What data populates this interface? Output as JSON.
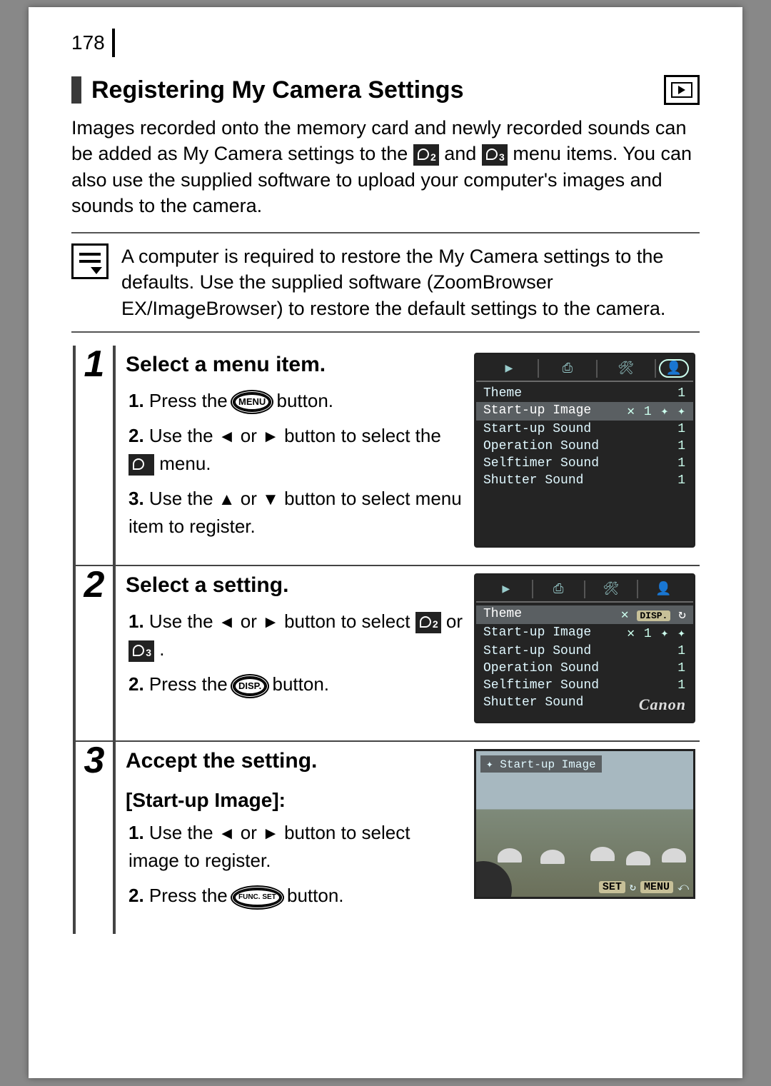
{
  "page_number": "178",
  "section_title": "Registering My Camera Settings",
  "intro": "Images recorded onto the memory card and newly recorded sounds can be added as My Camera settings to the     and     menu items. You can also use the supplied software to upload your computer's images and sounds to the camera.",
  "note": "A computer is required to restore the My Camera settings to the defaults. Use the supplied software (ZoomBrowser EX/ImageBrowser) to restore the default settings to the camera.",
  "steps": {
    "s1": {
      "num": "1",
      "title": "Select a menu item.",
      "li1_a": "1.",
      "li1_b": "Press the ",
      "li1_btn": "MENU",
      "li1_c": " button.",
      "li2_a": "2.",
      "li2_b": "Use the ",
      "li2_c": " or ",
      "li2_d": " button to select the ",
      "li2_e": " menu.",
      "li3_a": "3.",
      "li3_b": "Use the ",
      "li3_c": " or ",
      "li3_d": " button to select menu item to register."
    },
    "s2": {
      "num": "2",
      "title": "Select a setting.",
      "li1_a": "1.",
      "li1_b": "Use the ",
      "li1_c": " or ",
      "li1_d": " button to select ",
      "li1_e": " or ",
      "li1_f": ".",
      "li2_a": "2.",
      "li2_b": "Press the ",
      "li2_btn": "DISP.",
      "li2_c": " button."
    },
    "s3": {
      "num": "3",
      "title": "Accept the setting.",
      "sub": "[Start-up Image]:",
      "li1_a": "1.",
      "li1_b": "Use the ",
      "li1_c": " or ",
      "li1_d": " button to select image to register.",
      "li2_a": "2.",
      "li2_b": "Press the ",
      "li2_btn": "FUNC. SET",
      "li2_c": " button."
    }
  },
  "lcd1": {
    "rows": [
      {
        "label": "Theme",
        "val": "1"
      },
      {
        "label": "Start-up Image",
        "val": "✕ 1 ✦ ✦",
        "hl": true
      },
      {
        "label": "Start-up Sound",
        "val": "1"
      },
      {
        "label": "Operation Sound",
        "val": "1"
      },
      {
        "label": "Selftimer Sound",
        "val": "1"
      },
      {
        "label": "Shutter Sound",
        "val": "1"
      }
    ]
  },
  "lcd2": {
    "disp_badge": "DISP.",
    "rows": [
      {
        "label": "Theme",
        "val": "✕",
        "hl": true,
        "extra": true
      },
      {
        "label": "Start-up Image",
        "val": "✕ 1 ✦ ✦"
      },
      {
        "label": "Start-up Sound",
        "val": "1"
      },
      {
        "label": "Operation Sound",
        "val": "1"
      },
      {
        "label": "Selftimer Sound",
        "val": "1"
      },
      {
        "label": "Shutter Sound",
        "val": "Canon",
        "canon": true
      }
    ]
  },
  "photo": {
    "title": "Start-up Image",
    "set": "SET",
    "menu": "MENU"
  },
  "icons": {
    "left": "◄",
    "right": "►",
    "up": "▲",
    "down": "▼",
    "play": "▶",
    "print": "⎙",
    "tools": "🛠",
    "person": "👤",
    "mycam2": "2",
    "mycam3": "3"
  }
}
